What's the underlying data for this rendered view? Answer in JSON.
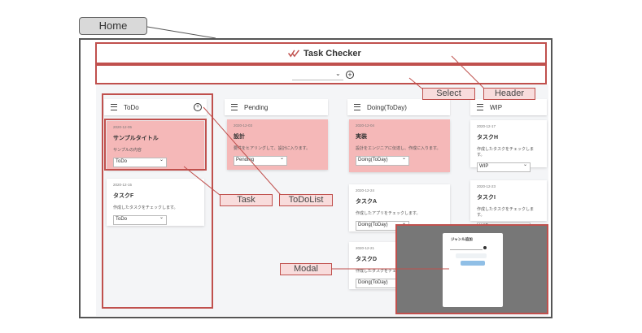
{
  "home_label": "Home",
  "app": {
    "title": "Task Checker"
  },
  "columns": [
    {
      "name": "ToDo",
      "cards": [
        {
          "date": "2020-12-05",
          "title": "サンプルタイトル",
          "body": "サンプルの内容",
          "status": "ToDo",
          "highlight": true
        },
        {
          "date": "2020-12-15",
          "title": "タスクF",
          "body": "作成したタスクをチェックします。",
          "status": "ToDo",
          "highlight": false
        }
      ]
    },
    {
      "name": "Pending",
      "cards": [
        {
          "date": "2020-12-03",
          "title": "設計",
          "body": "要件をヒアリングして、設計に入ります。",
          "status": "Pending",
          "highlight": true
        }
      ]
    },
    {
      "name": "Doing(ToDay)",
      "cards": [
        {
          "date": "2020-12-04",
          "title": "実装",
          "body": "設計をエンジニアに伝達し、作成に入ります。",
          "status": "Doing(ToDay)",
          "highlight": true
        },
        {
          "date": "2020-12-24",
          "title": "タスクA",
          "body": "作成したアプリをチェックします。",
          "status": "Doing(ToDay)",
          "highlight": false
        },
        {
          "date": "2020-12-21",
          "title": "タスクD",
          "body": "作成したタスクをチェ",
          "status": "Doing(ToDay)",
          "highlight": false
        }
      ]
    },
    {
      "name": "WIP",
      "cards": [
        {
          "date": "2020-12-17",
          "title": "タスクH",
          "body": "作成したタスクをチェックします。",
          "status": "WIP",
          "highlight": false
        },
        {
          "date": "2020-12-23",
          "title": "タスクI",
          "body": "作成したタスクをチェックします。",
          "status": "WIP",
          "highlight": false
        }
      ]
    }
  ],
  "callouts": {
    "select": "Select",
    "header": "Header",
    "task": "Task",
    "todolist": "ToDoList",
    "modal": "Modal"
  },
  "modal": {
    "title": "ジャンル追加"
  },
  "colors": {
    "annotation_red": "#c0504d",
    "card_pink": "#f5b8b8",
    "callout_fill": "#f8dcdc"
  }
}
